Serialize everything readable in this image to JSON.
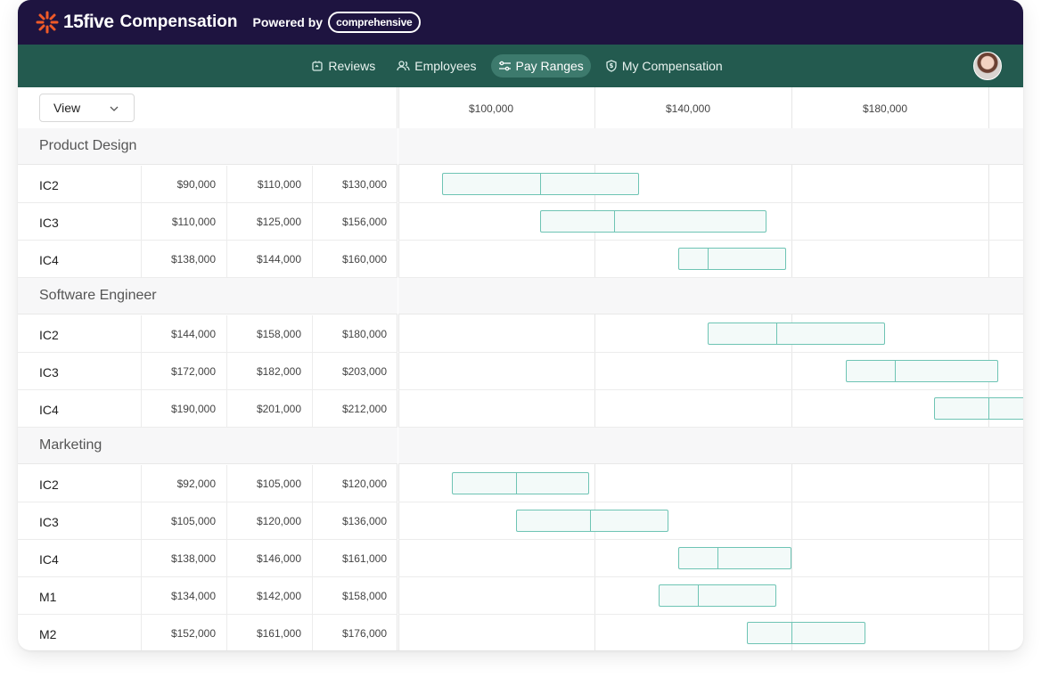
{
  "header": {
    "brand_name": "15five",
    "product": "Compensation",
    "powered_by": "Powered by",
    "partner": "comprehensive"
  },
  "nav": {
    "tabs": [
      {
        "label": "Reviews",
        "icon": "reviews-icon",
        "active": false
      },
      {
        "label": "Employees",
        "icon": "employees-icon",
        "active": false
      },
      {
        "label": "Pay Ranges",
        "icon": "pay-ranges-icon",
        "active": true
      },
      {
        "label": "My Compensation",
        "icon": "shield-dollar-icon",
        "active": false
      }
    ]
  },
  "toolbar": {
    "view_label": "View"
  },
  "axis": {
    "labels": [
      "$100,000",
      "$140,000",
      "$180,000"
    ]
  },
  "colors": {
    "topbar": "#1e1440",
    "navbar": "#235a4f",
    "active_tab": "#3d7a6d",
    "bar_border": "#6ec4b4",
    "bar_fill": "#f3faf9"
  },
  "chart_data": {
    "type": "bar",
    "axis_ticks": [
      100000,
      140000,
      180000
    ],
    "sections": [
      {
        "title": "Product Design",
        "rows": [
          {
            "level": "IC2",
            "min": "$90,000",
            "mid": "$110,000",
            "max": "$130,000",
            "min_v": 90000,
            "mid_v": 110000,
            "max_v": 130000
          },
          {
            "level": "IC3",
            "min": "$110,000",
            "mid": "$125,000",
            "max": "$156,000",
            "min_v": 110000,
            "mid_v": 125000,
            "max_v": 156000
          },
          {
            "level": "IC4",
            "min": "$138,000",
            "mid": "$144,000",
            "max": "$160,000",
            "min_v": 138000,
            "mid_v": 144000,
            "max_v": 160000
          }
        ]
      },
      {
        "title": "Software Engineer",
        "rows": [
          {
            "level": "IC2",
            "min": "$144,000",
            "mid": "$158,000",
            "max": "$180,000",
            "min_v": 144000,
            "mid_v": 158000,
            "max_v": 180000
          },
          {
            "level": "IC3",
            "min": "$172,000",
            "mid": "$182,000",
            "max": "$203,000",
            "min_v": 172000,
            "mid_v": 182000,
            "max_v": 203000
          },
          {
            "level": "IC4",
            "min": "$190,000",
            "mid": "$201,000",
            "max": "$212,000",
            "min_v": 190000,
            "mid_v": 201000,
            "max_v": 212000
          }
        ]
      },
      {
        "title": "Marketing",
        "rows": [
          {
            "level": "IC2",
            "min": "$92,000",
            "mid": "$105,000",
            "max": "$120,000",
            "min_v": 92000,
            "mid_v": 105000,
            "max_v": 120000
          },
          {
            "level": "IC3",
            "min": "$105,000",
            "mid": "$120,000",
            "max": "$136,000",
            "min_v": 105000,
            "mid_v": 120000,
            "max_v": 136000
          },
          {
            "level": "IC4",
            "min": "$138,000",
            "mid": "$146,000",
            "max": "$161,000",
            "min_v": 138000,
            "mid_v": 146000,
            "max_v": 161000
          },
          {
            "level": "M1",
            "min": "$134,000",
            "mid": "$142,000",
            "max": "$158,000",
            "min_v": 134000,
            "mid_v": 142000,
            "max_v": 158000
          },
          {
            "level": "M2",
            "min": "$152,000",
            "mid": "$161,000",
            "max": "$176,000",
            "min_v": 152000,
            "mid_v": 161000,
            "max_v": 176000
          }
        ]
      }
    ]
  }
}
